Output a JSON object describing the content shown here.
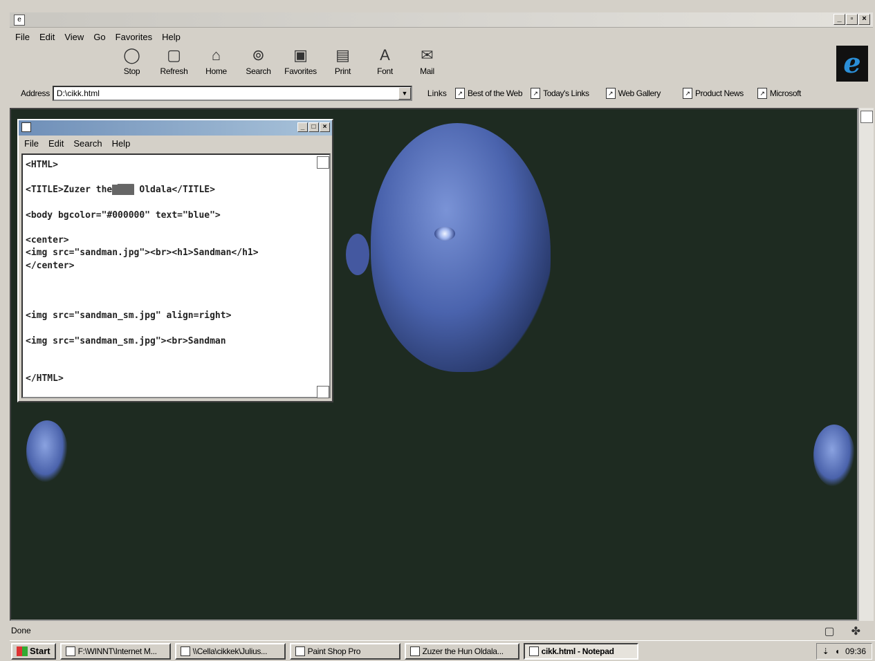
{
  "browser": {
    "menu": [
      "File",
      "Edit",
      "View",
      "Go",
      "Favorites",
      "Help"
    ],
    "toolbar": [
      {
        "label": "Stop",
        "icon": "stop-icon",
        "glyph": "◯"
      },
      {
        "label": "Refresh",
        "icon": "refresh-icon",
        "glyph": "▢"
      },
      {
        "label": "Home",
        "icon": "home-icon",
        "glyph": "⌂"
      },
      {
        "label": "Search",
        "icon": "search-icon",
        "glyph": "⊚"
      },
      {
        "label": "Favorites",
        "icon": "favorites-icon",
        "glyph": "▣"
      },
      {
        "label": "Print",
        "icon": "print-icon",
        "glyph": "▤"
      },
      {
        "label": "Font",
        "icon": "font-icon",
        "glyph": "A"
      },
      {
        "label": "Mail",
        "icon": "mail-icon",
        "glyph": "✉"
      }
    ],
    "address_label": "Address",
    "address_value": "D:\\cikk.html",
    "links_label": "Links",
    "links": [
      "Best of the Web",
      "Today's Links",
      "Web Gallery",
      "Product News",
      "Microsoft"
    ],
    "status": "Done"
  },
  "notepad": {
    "menu": [
      "File",
      "Edit",
      "Search",
      "Help"
    ],
    "lines": [
      "<HTML>",
      "",
      "<TITLE>Zuzer the",
      "",
      "<body bgcolor=\"#000000\" text=\"blue\">",
      "",
      "<center>",
      "<img src=\"sandman.jpg\"><br><h1>Sandman</h1>",
      "</center>",
      "",
      "",
      "",
      "<img src=\"sandman_sm.jpg\" align=right>",
      "",
      "<img src=\"sandman_sm.jpg\"><br>Sandman",
      "",
      "",
      "</HTML>"
    ],
    "title_line_tail": " Oldala</TITLE>"
  },
  "taskbar": {
    "start": "Start",
    "tasks": [
      "F:\\WINNT\\Internet M...",
      "\\\\Cella\\cikkek\\Julius...",
      "Paint Shop Pro",
      "Zuzer the Hun Oldala...",
      "cikk.html - Notepad"
    ],
    "clock": "09:36"
  },
  "colors": {
    "page_bg": "#1e2b21",
    "text_blue": "#4a63ad"
  }
}
